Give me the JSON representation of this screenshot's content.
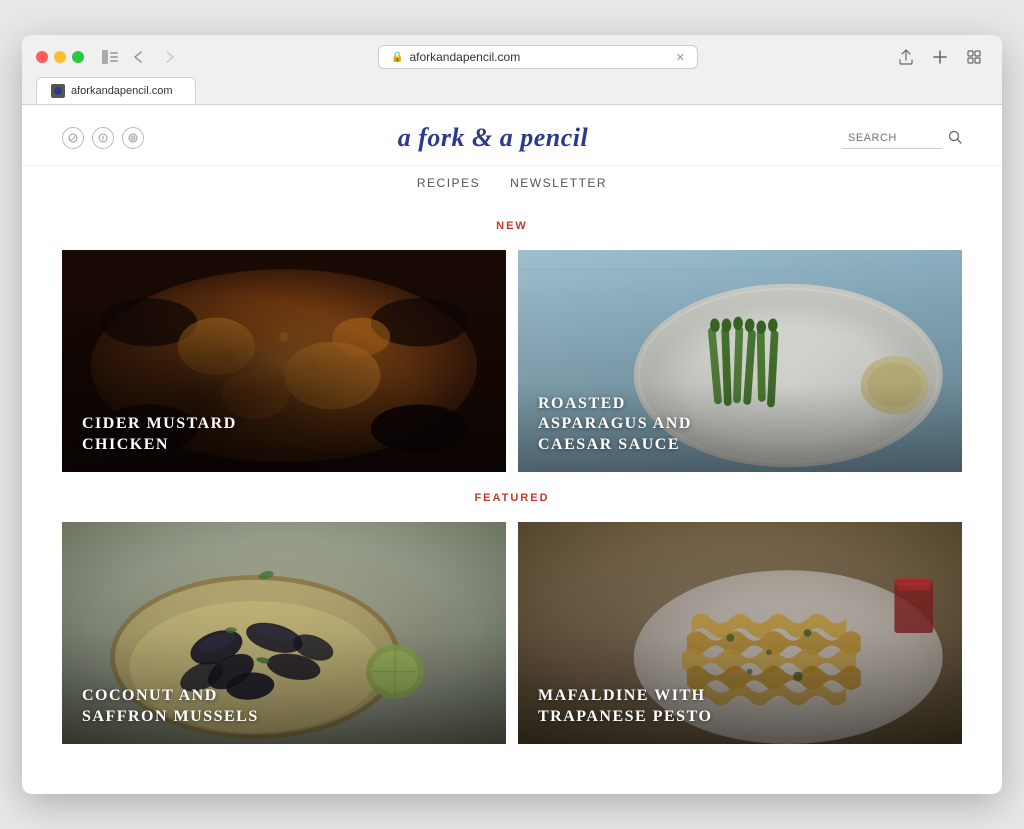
{
  "browser": {
    "traffic_lights": [
      "red",
      "yellow",
      "green"
    ],
    "url": "aforkandapencil.com",
    "tab_title": "aforkandapencil.com"
  },
  "site": {
    "title": "a fork & a pencil",
    "nav": [
      {
        "label": "RECIPES",
        "href": "#"
      },
      {
        "label": "NEWSLETTER",
        "href": "#"
      }
    ],
    "search_placeholder": "SEARCH",
    "social_icons": [
      {
        "name": "twitter-icon",
        "symbol": "◯"
      },
      {
        "name": "facebook-icon",
        "symbol": "f"
      },
      {
        "name": "instagram-icon",
        "symbol": "◯"
      }
    ]
  },
  "sections": [
    {
      "label": "NEW",
      "recipes": [
        {
          "title": "CIDER MUSTARD\nCHICKEN",
          "style": "cider"
        },
        {
          "title": "ROASTED\nASPARAGUS AND\nCAESAR SAUCE",
          "style": "asparagus"
        }
      ]
    },
    {
      "label": "FEATURED",
      "recipes": [
        {
          "title": "COCONUT AND\nSAFFRON MUSSELS",
          "style": "mussels"
        },
        {
          "title": "MAFALDINE WITH\nTRAPANESE PESTO",
          "style": "pasta"
        }
      ]
    }
  ]
}
